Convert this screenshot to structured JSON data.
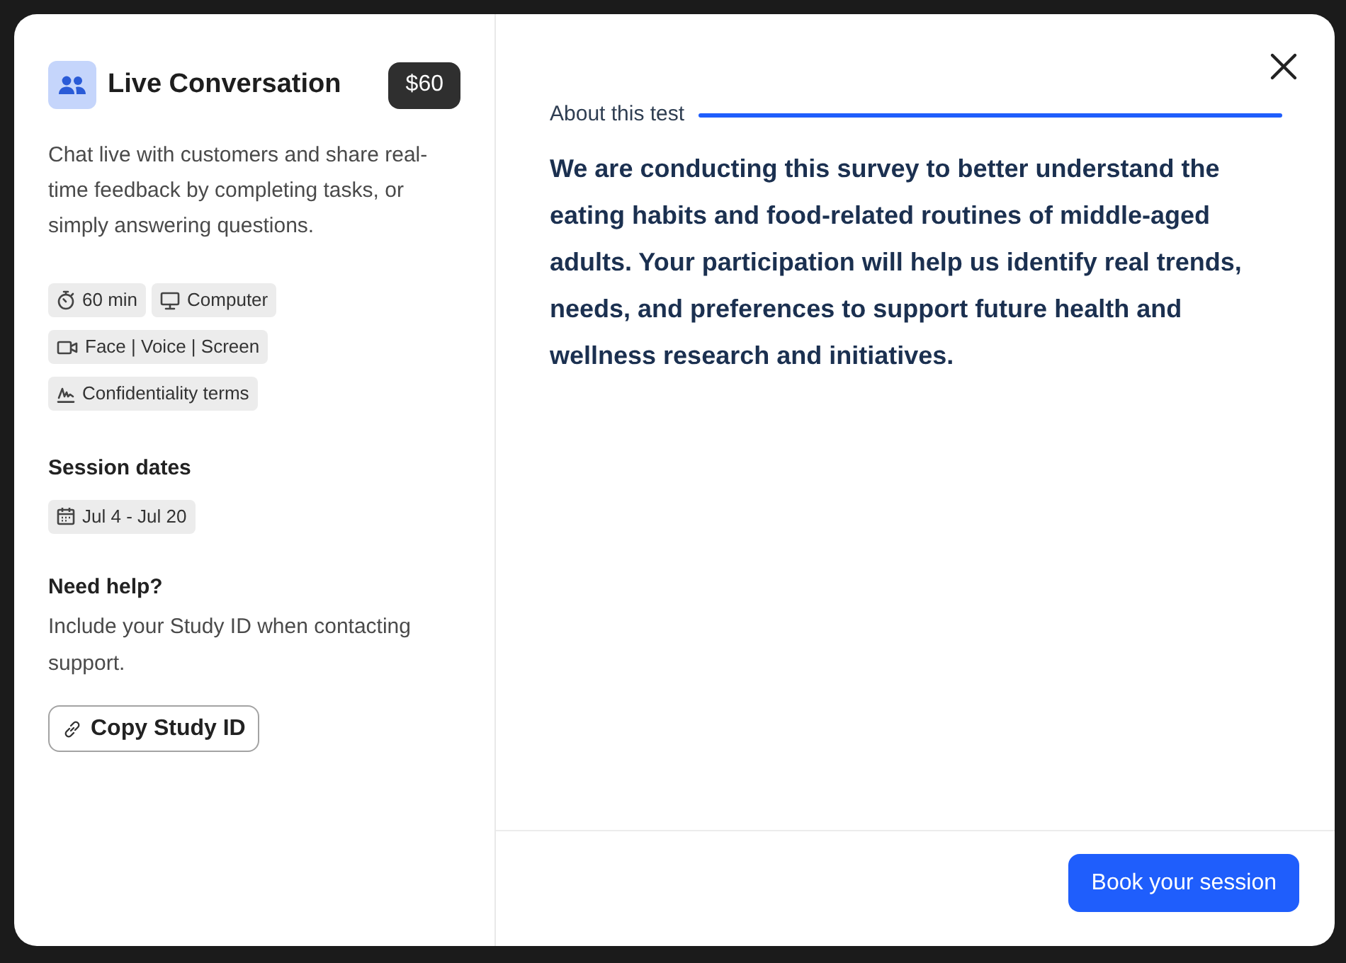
{
  "header": {
    "title": "Live Conversation",
    "price": "$60"
  },
  "description": "Chat live with customers and share real-time feedback by completing tasks, or simply answering questions.",
  "tags": [
    {
      "kind": "duration",
      "label": "60 min"
    },
    {
      "kind": "device",
      "label": "Computer"
    },
    {
      "kind": "recording",
      "label": "Face | Voice | Screen"
    },
    {
      "kind": "confidentiality",
      "label": "Confidentiality terms"
    }
  ],
  "session": {
    "heading": "Session dates",
    "dates": "Jul 4 - Jul 20"
  },
  "help": {
    "heading": "Need help?",
    "text": "Include your Study ID when contacting support.",
    "button": "Copy Study ID"
  },
  "about": {
    "label": "About this test",
    "text": "We are conducting this survey to better understand the eating habits and food-related routines of middle-aged adults. Your participation will help us identify real trends, needs, and preferences to support future health and wellness research and initiatives."
  },
  "footer": {
    "button": "Book your session"
  }
}
